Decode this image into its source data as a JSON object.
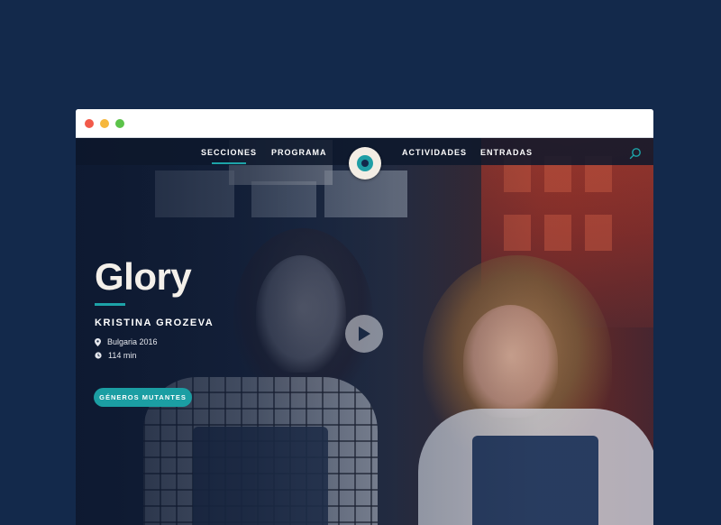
{
  "nav": {
    "items": [
      {
        "label": "SECCIONES",
        "active": true
      },
      {
        "label": "PROGRAMA",
        "active": false
      },
      {
        "label": "ACTIVIDADES",
        "active": false
      },
      {
        "label": "ENTRADAS",
        "active": false
      }
    ]
  },
  "film": {
    "title": "Glory",
    "director": "KRISTINA GROZEVA",
    "country_year": "Bulgaria 2016",
    "duration": "114 min",
    "genre_button": "GÉNEROS MUTANTES"
  },
  "icons": {
    "logo": "eye-logo-icon",
    "search": "search-icon",
    "location": "map-pin-icon",
    "clock": "clock-icon",
    "play": "play-icon"
  },
  "colors": {
    "page_background": "#13294b",
    "accent": "#1da3a8",
    "navbar": "#0d182c",
    "title_text": "#f4f0ea"
  }
}
